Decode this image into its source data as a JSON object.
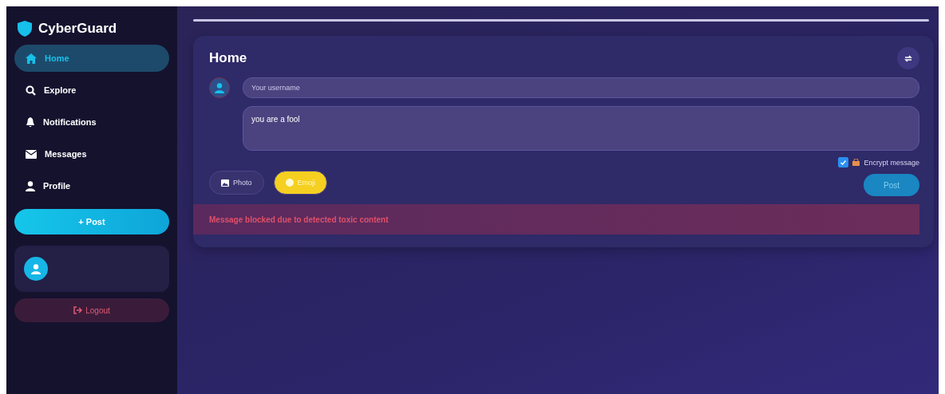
{
  "brand": "CyberGuard",
  "nav": [
    {
      "label": "Home",
      "kind": "home",
      "selected": true
    },
    {
      "label": "Explore",
      "kind": "search",
      "selected": false
    },
    {
      "label": "Notifications",
      "kind": "bell",
      "selected": false
    },
    {
      "label": "Messages",
      "kind": "mail",
      "selected": false
    },
    {
      "label": "Profile",
      "kind": "user",
      "selected": false
    }
  ],
  "post_button": "+ Post",
  "logout": "Logout",
  "composer": {
    "title": "Home",
    "username": {
      "placeholder": "Your username"
    },
    "message": "you are a fool",
    "attachments": [
      {
        "label": "Photo",
        "kind": "photo"
      },
      {
        "label": "Emoji",
        "kind": "emoji"
      }
    ],
    "encrypt": {
      "label": "Encrypt message",
      "checked": true
    },
    "post": "Post",
    "alert": "Message blocked due to detected toxic content"
  }
}
